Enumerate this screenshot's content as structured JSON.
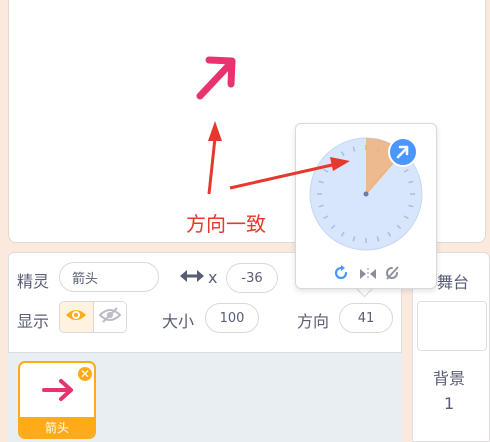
{
  "sprite_info": {
    "sprite_label": "精灵",
    "sprite_name": "箭头",
    "x_label": "x",
    "x_value": "-36",
    "show_label": "显示",
    "size_label": "大小",
    "size_value": "100",
    "direction_label": "方向",
    "direction_value": "41"
  },
  "sprite_list": {
    "items": [
      {
        "name": "箭头",
        "selected": true
      }
    ]
  },
  "stage_pane": {
    "title": "舞台",
    "backdrops_label": "背景",
    "backdrops_count": "1"
  },
  "annotation": {
    "text": "方向一致"
  },
  "colors": {
    "accent": "#ffab19",
    "arrow_pink": "#e8336f",
    "annotation_red": "#e5392e",
    "dial_blue": "#4c97ff"
  },
  "icons": [
    "left-right-arrow-icon",
    "eye-icon",
    "eye-slash-icon",
    "rotate-all-around-icon",
    "left-right-only-icon",
    "dont-rotate-icon",
    "close-icon"
  ]
}
